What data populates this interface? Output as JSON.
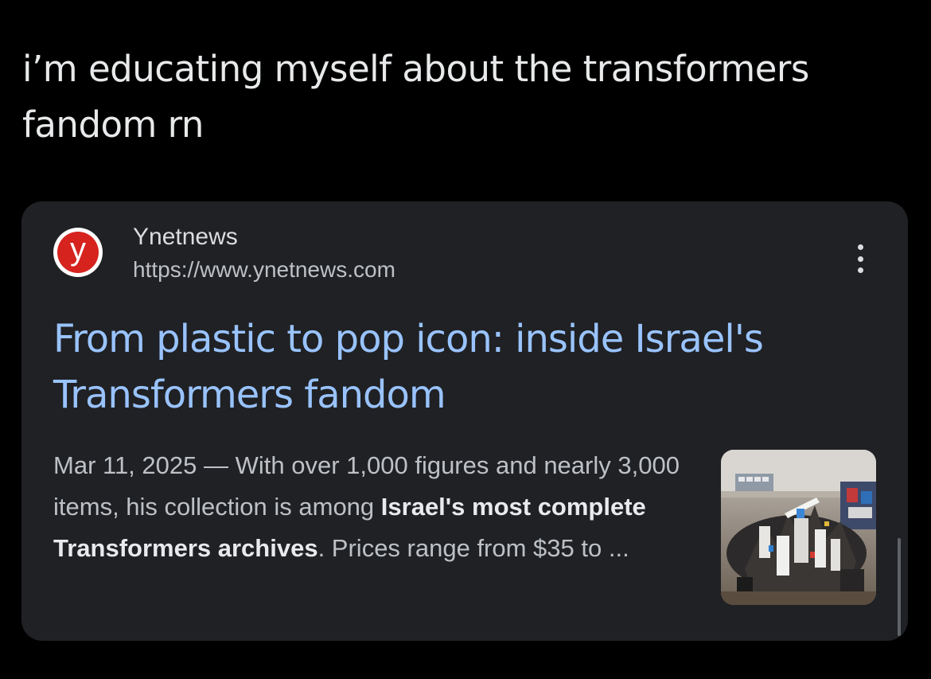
{
  "tweet": {
    "text_line1": "i’m educating myself about the transformers",
    "text_line2": "fandom rn"
  },
  "result": {
    "favicon_letter": "y",
    "favicon_color": "#d6231e",
    "site_name": "Ynetnews",
    "site_url": "https://www.ynetnews.com",
    "more_icon": "more-vert-icon",
    "title_line1": "From plastic to pop icon: inside Israel's",
    "title_line2": "Transformers fandom",
    "title_color": "#99c3ff",
    "snippet_date": "Mar 11, 2025",
    "snippet_sep": " — ",
    "snippet_text1": "With over 1,000 figures and nearly 3,000 items, his collection is among ",
    "snippet_bold": "Israel's most complete Transformers archives",
    "snippet_text2": ". Prices range from $35 to ...",
    "thumbnail": "transformers-figures-collection-thumbnail"
  }
}
